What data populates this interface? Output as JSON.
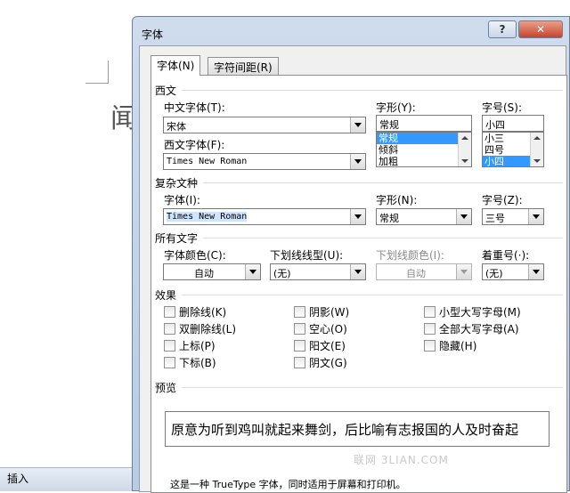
{
  "document": {
    "visible_char": "闻"
  },
  "statusbar": {
    "insert_label": "插入"
  },
  "dialog": {
    "title": "字体",
    "help_label": "?",
    "close_label": "✕",
    "tabs": [
      {
        "label": "字体(N)",
        "active": true
      },
      {
        "label": "字符间距(R)",
        "active": false
      }
    ]
  },
  "western": {
    "section_label": "西文",
    "cn_font_label": "中文字体(T):",
    "cn_font_value": "宋体",
    "west_font_label": "西文字体(F):",
    "west_font_value": "Times New Roman",
    "style_label": "字形(Y):",
    "style_value": "常规",
    "style_options": [
      "常规",
      "倾斜",
      "加粗"
    ],
    "size_label": "字号(S):",
    "size_value": "小四",
    "size_options": [
      "小三",
      "四号",
      "小四"
    ]
  },
  "complex": {
    "section_label": "复杂文种",
    "font_label": "字体(I):",
    "font_value": "Times New Roman",
    "style_label": "字形(N):",
    "style_value": "常规",
    "size_label": "字号(Z):",
    "size_value": "三号"
  },
  "alltext": {
    "section_label": "所有文字",
    "color_label": "字体颜色(C):",
    "color_value": "自动",
    "underline_label": "下划线线型(U):",
    "underline_value": "(无)",
    "underline_color_label": "下划线颜色(I):",
    "underline_color_value": "自动",
    "emphasis_label": "着重号(·):",
    "emphasis_value": "(无)"
  },
  "effects": {
    "section_label": "效果",
    "col1": [
      "删除线(K)",
      "双删除线(L)",
      "上标(P)",
      "下标(B)"
    ],
    "col2": [
      "阴影(W)",
      "空心(O)",
      "阳文(E)",
      "阴文(G)"
    ],
    "col3": [
      "小型大写字母(M)",
      "全部大写字母(A)",
      "隐藏(H)"
    ]
  },
  "preview": {
    "section_label": "预览",
    "text": "原意为听到鸡叫就起来舞剑，后比喻有志报国的人及时奋起",
    "watermark": "联网 3LIAN.COM",
    "info": "这是一种 TrueType 字体，同时适用于屏幕和打印机。"
  }
}
